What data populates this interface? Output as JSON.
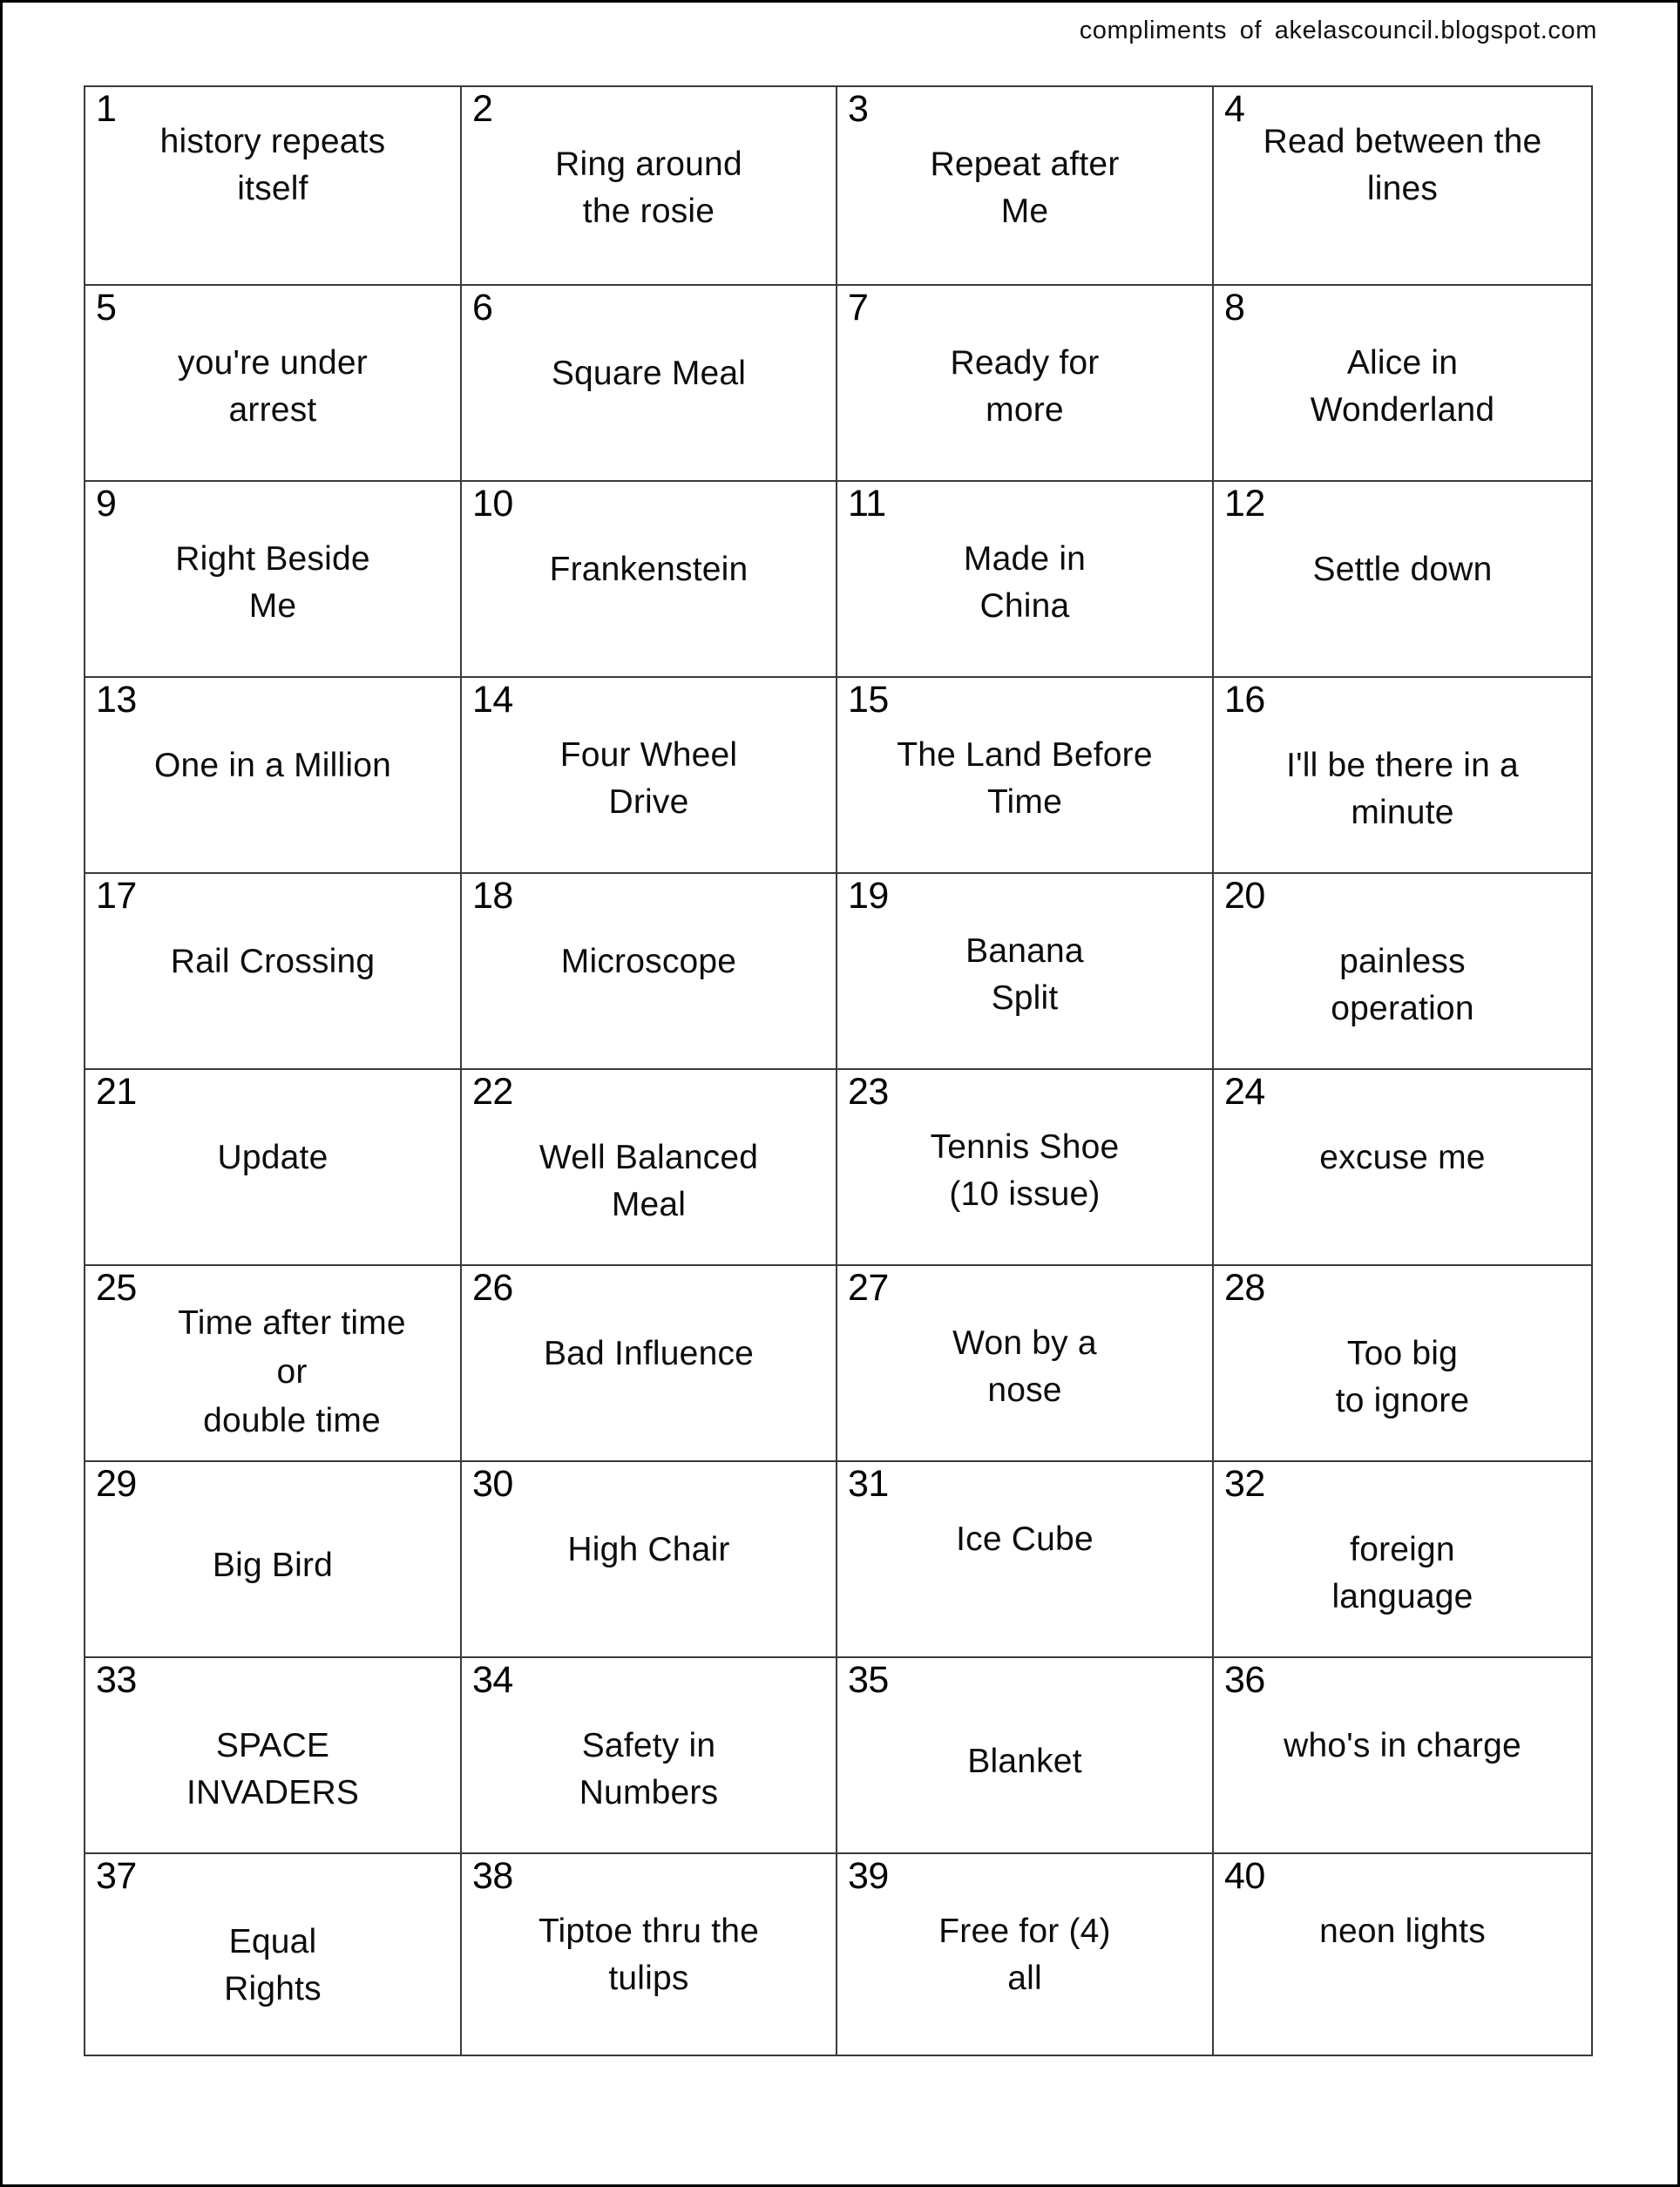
{
  "header": {
    "credit": "compliments of  akelascouncil.blogspot.com"
  },
  "colors": {
    "page_border": "#000000",
    "grid_line": "#3a3a3a",
    "text": "#0d0d0d",
    "background": "#ffffff"
  },
  "grid": {
    "columns": 4,
    "rows": 10,
    "total_cells": 40,
    "cells": [
      {
        "number": "1",
        "phrase": "history repeats itself",
        "lines": [
          "history repeats",
          "itself"
        ],
        "align": "v-top"
      },
      {
        "number": "2",
        "phrase": "Ring around the rosie",
        "lines": [
          "Ring around",
          "the rosie"
        ],
        "align": "v-mid"
      },
      {
        "number": "3",
        "phrase": "Repeat after Me",
        "lines": [
          "Repeat after",
          "Me"
        ],
        "align": "v-mid"
      },
      {
        "number": "4",
        "phrase": "Read between the lines",
        "lines": [
          "Read between the",
          "lines"
        ],
        "align": "v-top"
      },
      {
        "number": "5",
        "phrase": "you're under arrest",
        "lines": [
          "you're under",
          "arrest"
        ],
        "align": "v-mid"
      },
      {
        "number": "6",
        "phrase": "Square Meal",
        "lines": [
          "Square Meal"
        ],
        "align": "v-mid2"
      },
      {
        "number": "7",
        "phrase": "Ready for more",
        "lines": [
          "Ready for",
          "more"
        ],
        "align": "v-mid"
      },
      {
        "number": "8",
        "phrase": "Alice in Wonderland",
        "lines": [
          "Alice in",
          "Wonderland"
        ],
        "align": "v-mid"
      },
      {
        "number": "9",
        "phrase": "Right Beside Me",
        "lines": [
          "Right Beside",
          "Me"
        ],
        "align": "v-mid"
      },
      {
        "number": "10",
        "phrase": "Frankenstein",
        "lines": [
          "Frankenstein"
        ],
        "align": "v-mid2"
      },
      {
        "number": "11",
        "phrase": "Made in China",
        "lines": [
          "Made in",
          "China"
        ],
        "align": "v-mid"
      },
      {
        "number": "12",
        "phrase": "Settle down",
        "lines": [
          "Settle down"
        ],
        "align": "v-mid2"
      },
      {
        "number": "13",
        "phrase": "One in a Million",
        "lines": [
          "One in a Million"
        ],
        "align": "v-mid2"
      },
      {
        "number": "14",
        "phrase": "Four Wheel Drive",
        "lines": [
          "Four Wheel",
          "Drive"
        ],
        "align": "v-mid"
      },
      {
        "number": "15",
        "phrase": "The Land Before Time",
        "lines": [
          "The Land Before",
          "Time"
        ],
        "align": "v-mid"
      },
      {
        "number": "16",
        "phrase": "I'll be there in a minute",
        "lines": [
          "I'll be there in a",
          "minute"
        ],
        "align": "v-mid2"
      },
      {
        "number": "17",
        "phrase": "Rail Crossing",
        "lines": [
          "Rail Crossing"
        ],
        "align": "v-mid2"
      },
      {
        "number": "18",
        "phrase": "Microscope",
        "lines": [
          "Microscope"
        ],
        "align": "v-mid2"
      },
      {
        "number": "19",
        "phrase": "Banana Split",
        "lines": [
          "Banana",
          "Split"
        ],
        "align": "v-mid"
      },
      {
        "number": "20",
        "phrase": "painless operation",
        "lines": [
          "painless",
          "operation"
        ],
        "align": "v-mid2"
      },
      {
        "number": "21",
        "phrase": "Update",
        "lines": [
          "Update"
        ],
        "align": "v-mid2"
      },
      {
        "number": "22",
        "phrase": "Well Balanced Meal",
        "lines": [
          "Well Balanced",
          "Meal"
        ],
        "align": "v-mid2"
      },
      {
        "number": "23",
        "phrase": "Tennis Shoe (10 issue)",
        "lines": [
          "Tennis Shoe",
          "(10 issue)"
        ],
        "align": "v-mid"
      },
      {
        "number": "24",
        "phrase": "excuse me",
        "lines": [
          "excuse me"
        ],
        "align": "v-mid2"
      },
      {
        "number": "25",
        "phrase": "Time after time or double time",
        "lines": [
          "Time after time",
          "or",
          "double time"
        ],
        "align": "tight25"
      },
      {
        "number": "26",
        "phrase": "Bad Influence",
        "lines": [
          "Bad Influence"
        ],
        "align": "v-mid2"
      },
      {
        "number": "27",
        "phrase": "Won by a nose",
        "lines": [
          "Won by a",
          "nose"
        ],
        "align": "v-mid"
      },
      {
        "number": "28",
        "phrase": "Too big to ignore",
        "lines": [
          "Too big",
          "to ignore"
        ],
        "align": "v-mid2"
      },
      {
        "number": "29",
        "phrase": "Big Bird",
        "lines": [
          "Big Bird"
        ],
        "align": "v-low"
      },
      {
        "number": "30",
        "phrase": "High Chair",
        "lines": [
          "High Chair"
        ],
        "align": "v-mid2"
      },
      {
        "number": "31",
        "phrase": "Ice Cube",
        "lines": [
          "Ice Cube"
        ],
        "align": "v-mid"
      },
      {
        "number": "32",
        "phrase": "foreign language",
        "lines": [
          "foreign",
          "language"
        ],
        "align": "v-mid2"
      },
      {
        "number": "33",
        "phrase": "SPACE INVADERS",
        "lines": [
          "SPACE",
          "INVADERS"
        ],
        "align": "v-mid2"
      },
      {
        "number": "34",
        "phrase": "Safety in Numbers",
        "lines": [
          "Safety in",
          "Numbers"
        ],
        "align": "v-mid2"
      },
      {
        "number": "35",
        "phrase": "Blanket",
        "lines": [
          "Blanket"
        ],
        "align": "v-low"
      },
      {
        "number": "36",
        "phrase": "who's in charge",
        "lines": [
          "who's in charge"
        ],
        "align": "v-mid2"
      },
      {
        "number": "37",
        "phrase": "Equal Rights",
        "lines": [
          "Equal",
          "Rights"
        ],
        "align": "v-mid2"
      },
      {
        "number": "38",
        "phrase": "Tiptoe thru the tulips",
        "lines": [
          "Tiptoe thru the",
          "tulips"
        ],
        "align": "v-mid"
      },
      {
        "number": "39",
        "phrase": "Free for (4) all",
        "lines": [
          "Free for (4)",
          "all"
        ],
        "align": "v-mid"
      },
      {
        "number": "40",
        "phrase": "neon lights",
        "lines": [
          "neon lights"
        ],
        "align": "v-mid"
      }
    ]
  }
}
